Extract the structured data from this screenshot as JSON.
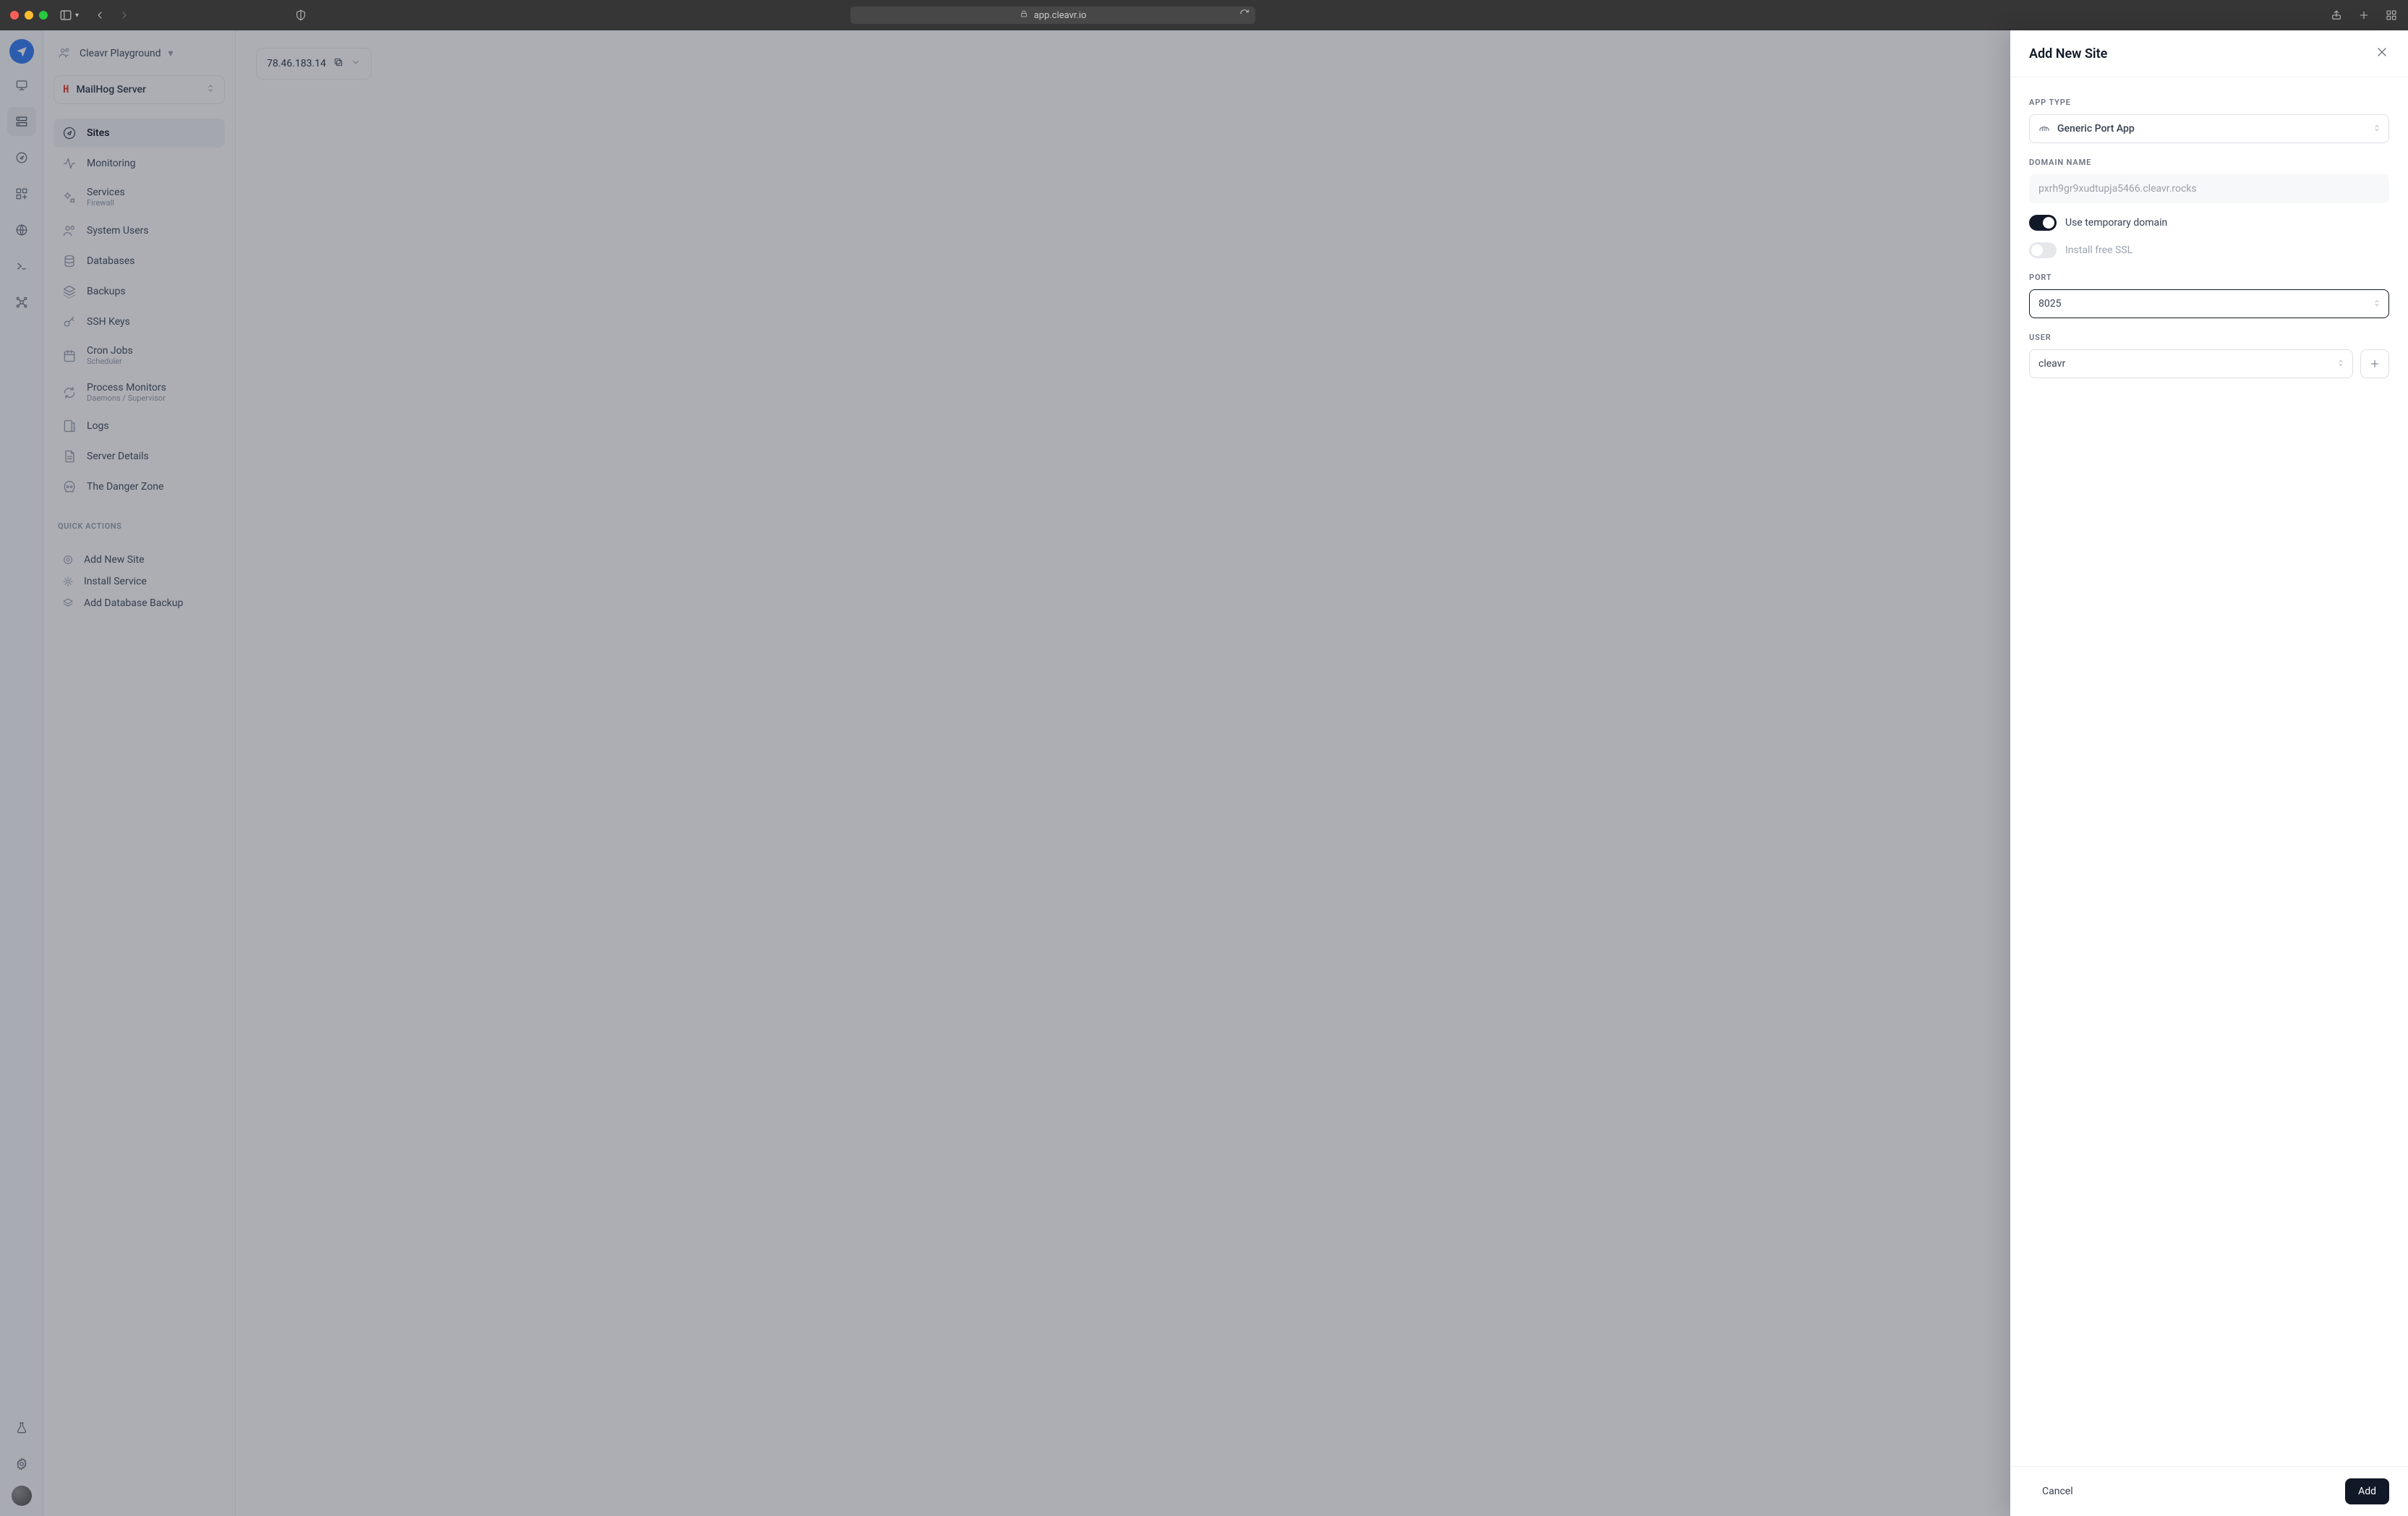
{
  "browser": {
    "url": "app.cleavr.io"
  },
  "org": {
    "name": "Cleavr Playground"
  },
  "server": {
    "name": "MailHog Server",
    "ip": "78.46.183.14"
  },
  "nav": {
    "sites": "Sites",
    "monitoring": "Monitoring",
    "services": "Services",
    "services_sub": "Firewall",
    "system_users": "System Users",
    "databases": "Databases",
    "backups": "Backups",
    "ssh_keys": "SSH Keys",
    "cron_jobs": "Cron Jobs",
    "cron_jobs_sub": "Scheduler",
    "process_monitors": "Process Monitors",
    "process_monitors_sub": "Daemons  /  Supervisor",
    "logs": "Logs",
    "server_details": "Server Details",
    "danger_zone": "The Danger Zone"
  },
  "quick_actions": {
    "label": "QUICK ACTIONS",
    "add_site": "Add New Site",
    "install_service": "Install Service",
    "add_db_backup": "Add Database Backup"
  },
  "drawer": {
    "title": "Add New Site",
    "labels": {
      "app_type": "APP TYPE",
      "domain_name": "DOMAIN NAME",
      "port": "PORT",
      "user": "USER"
    },
    "app_type_value": "Generic Port App",
    "domain_placeholder": "pxrh9gr9xudtupja5466.cleavr.rocks",
    "use_temp_domain_label": "Use temporary domain",
    "install_ssl_label": "Install free SSL",
    "port_value": "8025",
    "user_value": "cleavr",
    "cancel": "Cancel",
    "add": "Add"
  }
}
